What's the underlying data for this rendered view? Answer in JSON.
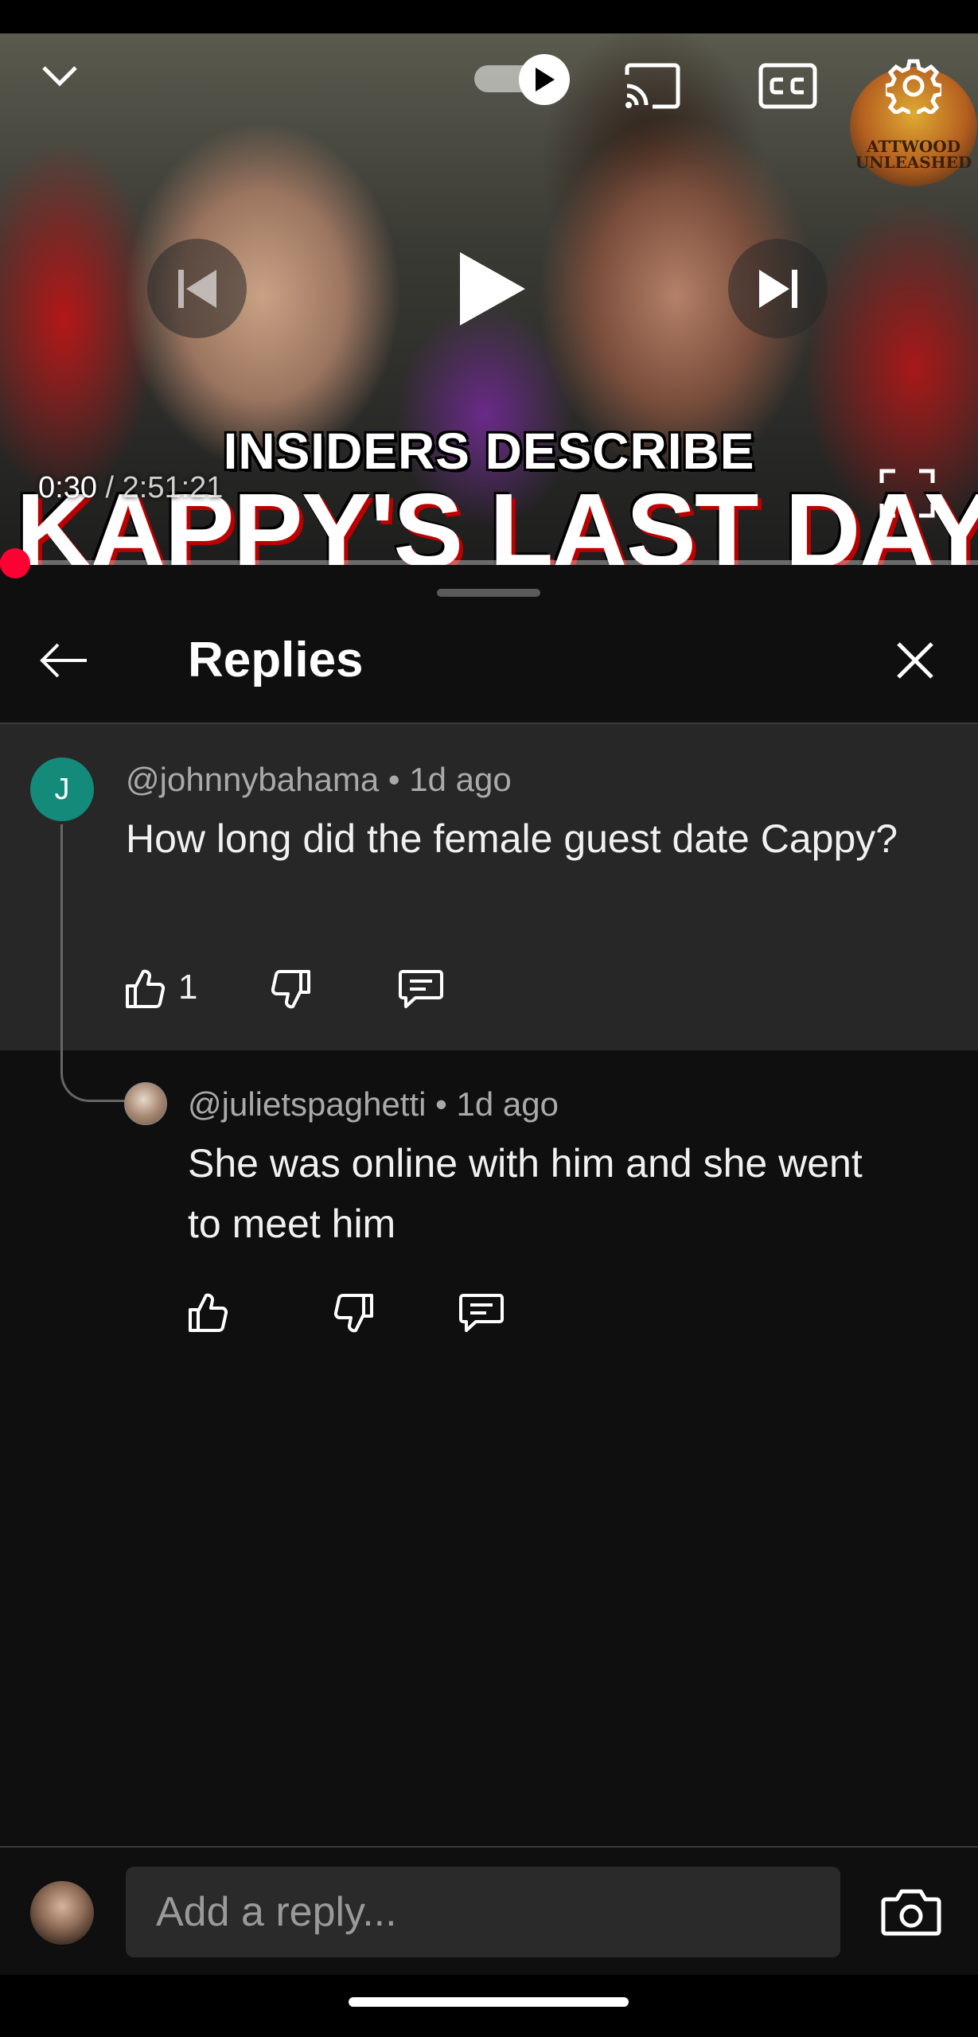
{
  "video": {
    "headline_top": "INSIDERS DESCRIBE",
    "headline_main": "KAPPY'S LAST DAYS!",
    "current_time": "0:30",
    "separator": " / ",
    "duration": "2:51:21",
    "progress_fraction": 0.003,
    "channel_badge_line1": "ATTWOOD",
    "channel_badge_line2": "UNLEASHED",
    "icons": [
      "chevron-down-icon",
      "autoplay-toggle",
      "cast-icon",
      "cc-icon",
      "gear-icon",
      "previous-icon",
      "play-icon",
      "next-icon",
      "fullscreen-icon"
    ]
  },
  "sheet": {
    "title": "Replies"
  },
  "parent_comment": {
    "avatar_letter": "J",
    "avatar_color": "#138a7a",
    "author": "@johnnybahama",
    "dot": " • ",
    "time": "1d ago",
    "text": "How long did the female guest date Cappy?",
    "like_count": "1"
  },
  "reply": {
    "author": "@julietspaghetti",
    "dot": " • ",
    "time": "1d ago",
    "text": "She was online with him and she went to meet him"
  },
  "composer": {
    "placeholder": "Add a reply..."
  },
  "colors": {
    "accent": "#ff0033",
    "background": "#0f0f0f",
    "parent_highlight": "#272727"
  }
}
